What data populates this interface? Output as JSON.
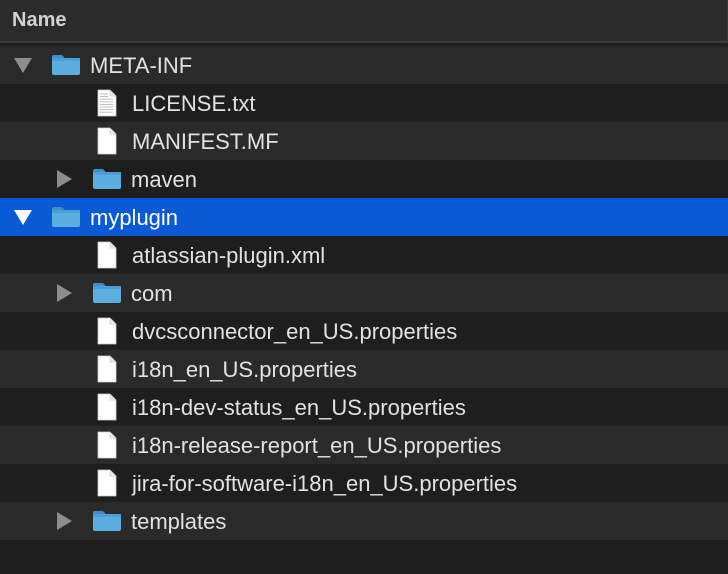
{
  "header": {
    "name_label": "Name"
  },
  "colors": {
    "selection": "#0a5ad6",
    "folder": "#5aaee0",
    "row_alt": "#2a2a2a",
    "background": "#1e1e1e"
  },
  "rows": [
    {
      "label": "META-INF",
      "type": "folder",
      "depth": 0,
      "disclosure": "expanded",
      "icon": "folder-icon"
    },
    {
      "label": "LICENSE.txt",
      "type": "file",
      "depth": 1,
      "icon": "text-file-icon"
    },
    {
      "label": "MANIFEST.MF",
      "type": "file",
      "depth": 1,
      "icon": "file-icon"
    },
    {
      "label": "maven",
      "type": "folder",
      "depth": 1,
      "disclosure": "collapsed",
      "icon": "folder-icon"
    },
    {
      "label": "myplugin",
      "type": "folder",
      "depth": 0,
      "disclosure": "expanded",
      "selected": true,
      "icon": "folder-icon"
    },
    {
      "label": "atlassian-plugin.xml",
      "type": "file",
      "depth": 1,
      "icon": "file-icon"
    },
    {
      "label": "com",
      "type": "folder",
      "depth": 1,
      "disclosure": "collapsed",
      "icon": "folder-icon"
    },
    {
      "label": "dvcsconnector_en_US.properties",
      "type": "file",
      "depth": 1,
      "icon": "file-icon"
    },
    {
      "label": "i18n_en_US.properties",
      "type": "file",
      "depth": 1,
      "icon": "file-icon"
    },
    {
      "label": "i18n-dev-status_en_US.properties",
      "type": "file",
      "depth": 1,
      "icon": "file-icon"
    },
    {
      "label": "i18n-release-report_en_US.properties",
      "type": "file",
      "depth": 1,
      "icon": "file-icon"
    },
    {
      "label": "jira-for-software-i18n_en_US.properties",
      "type": "file",
      "depth": 1,
      "icon": "file-icon"
    },
    {
      "label": "templates",
      "type": "folder",
      "depth": 1,
      "disclosure": "collapsed",
      "icon": "folder-icon"
    }
  ]
}
